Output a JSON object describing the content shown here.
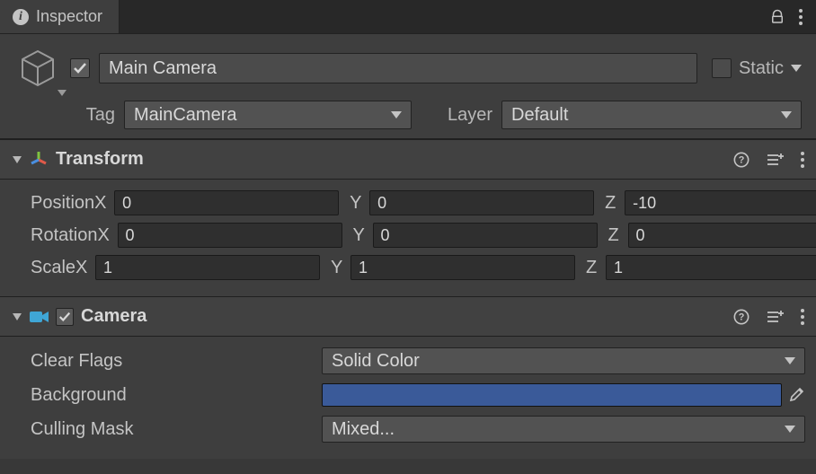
{
  "tab": {
    "title": "Inspector"
  },
  "object": {
    "enabled": true,
    "name": "Main Camera",
    "static_label": "Static",
    "tag_label": "Tag",
    "tag_value": "MainCamera",
    "layer_label": "Layer",
    "layer_value": "Default"
  },
  "transform": {
    "title": "Transform",
    "position_label": "Position",
    "rotation_label": "Rotation",
    "scale_label": "Scale",
    "axis": {
      "x": "X",
      "y": "Y",
      "z": "Z"
    },
    "position": {
      "x": "0",
      "y": "0",
      "z": "-10"
    },
    "rotation": {
      "x": "0",
      "y": "0",
      "z": "0"
    },
    "scale": {
      "x": "1",
      "y": "1",
      "z": "1"
    }
  },
  "camera": {
    "title": "Camera",
    "enabled": true,
    "clear_flags_label": "Clear Flags",
    "clear_flags_value": "Solid Color",
    "background_label": "Background",
    "background_color": "#3a5a99",
    "culling_mask_label": "Culling Mask",
    "culling_mask_value": "Mixed..."
  }
}
